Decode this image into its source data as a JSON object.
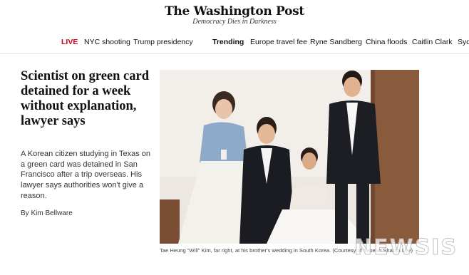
{
  "header": {
    "logo": "The Washington Post",
    "tagline": "Democracy Dies in Darkness"
  },
  "nav": {
    "live": "LIVE",
    "items": [
      "NYC shooting",
      "Trump presidency"
    ],
    "trending_label": "Trending",
    "trending": [
      "Europe travel fee",
      "Ryne Sandberg",
      "China floods",
      "Caitlin Clark",
      "Syd"
    ]
  },
  "article": {
    "headline": "Scientist on green card detained for a week without explanation, lawyer says",
    "summary": "A Korean citizen studying in Texas on a green card was detained in San Francisco after a trip overseas. His lawyer says authorities won't give a reason.",
    "byline_prefix": "By",
    "author": "Kim Bellware"
  },
  "photo": {
    "caption": "Tae Heung \"Will\" Kim, far right, at his brother's wedding in South Korea. (Courtesy of Yeoeun Sharon Lee)"
  },
  "watermark": "NEWSIS",
  "colors": {
    "live_red": "#d0021b",
    "divider": "#e6e6e6"
  }
}
